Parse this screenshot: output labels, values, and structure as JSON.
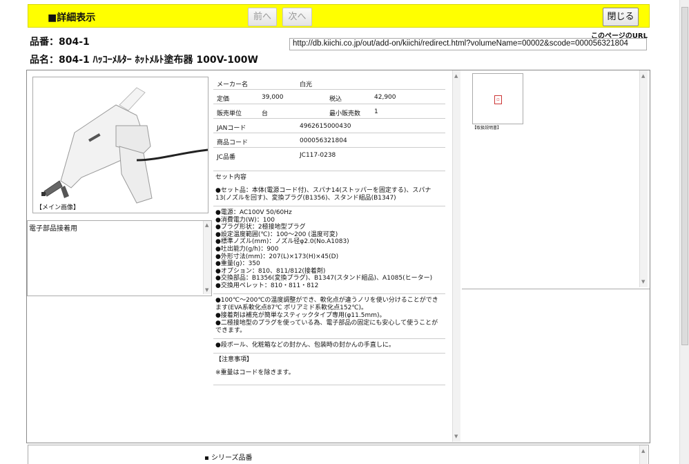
{
  "header": {
    "title": "■詳細表示",
    "prev_label": "前へ",
    "next_label": "次へ",
    "close_label": "閉じる"
  },
  "product": {
    "hinban_line": "品番：804-1",
    "hinmei_line": "品名：804-1 ﾊｯｺｰﾒﾙﾀｰ ﾎｯﾄﾒﾙﾄ塗布器 100V-100W",
    "page_url_label": "このページのURL",
    "page_url": "http://db.kiichi.co.jp/out/add-on/kiichi/redirect.html?volumeName=00002&scode=000056321804"
  },
  "image": {
    "caption": "【メイン画像】",
    "note": "電子部品接着用"
  },
  "spec": {
    "maker_label": "メーカー名",
    "maker_value": "白光",
    "price_label": "定価",
    "price_value": "39,000",
    "tax_label": "税込",
    "tax_value": "42,900",
    "unit_label": "販売単位",
    "unit_value": "台",
    "min_label": "最小販売数",
    "min_value": "1",
    "jan_label": "JANコード",
    "jan_value": "4962615000430",
    "code_label": "商品コード",
    "code_value": "000056321804",
    "jc_label": "JC品番",
    "jc_value": "JC117-0238",
    "set_title": "セット内容",
    "set_body": "●セット品：本体(電源コード付)、スパナ14(ストッパーを固定する)、スパナ13(ノズルを回す)、変換プラグ(B1356)、スタンド組品(B1347)",
    "specs": [
      "●電源：AC100V 50/60Hz",
      "●消費電力(W)：100",
      "●プラグ形状：2極接地型プラグ",
      "●設定温度範囲(℃)：100～200 (温度可変)",
      "●標準ノズル(mm)：ノズル径φ2.0(No.A1083)",
      "●吐出能力(g/h)：900",
      "●外形寸法(mm)：207(L)×173(H)×45(D)",
      "●重量(g)：350",
      "●オプション：810、811/812(接着剤)",
      "●交換部品：B1356(変換プラグ)、B1347(スタンド組品)、A1085(ヒーター)",
      "●交換用ペレット：810・811・812"
    ],
    "features": [
      "●100℃～200℃の温度調整ができ、軟化点が違うノリを使い分けることができます(EVA系軟化点87℃ ポリアミド系軟化点152℃)。",
      "●接着剤は補充が簡単なスティックタイプ専用(φ11.5mm)。",
      "●二極接地型のプラグを使っている為、電子部品の固定にも安心して使うことができます。"
    ],
    "usage": "●段ボール、化粧箱などの封かん、包装時の封かんの手直しに。",
    "caution_title": "【注意事項】",
    "caution_body": "※重量はコードを除きます。"
  },
  "side": {
    "thumb_caption": "【取扱説明書】"
  },
  "footer": {
    "series_label": "シリーズ品番"
  }
}
